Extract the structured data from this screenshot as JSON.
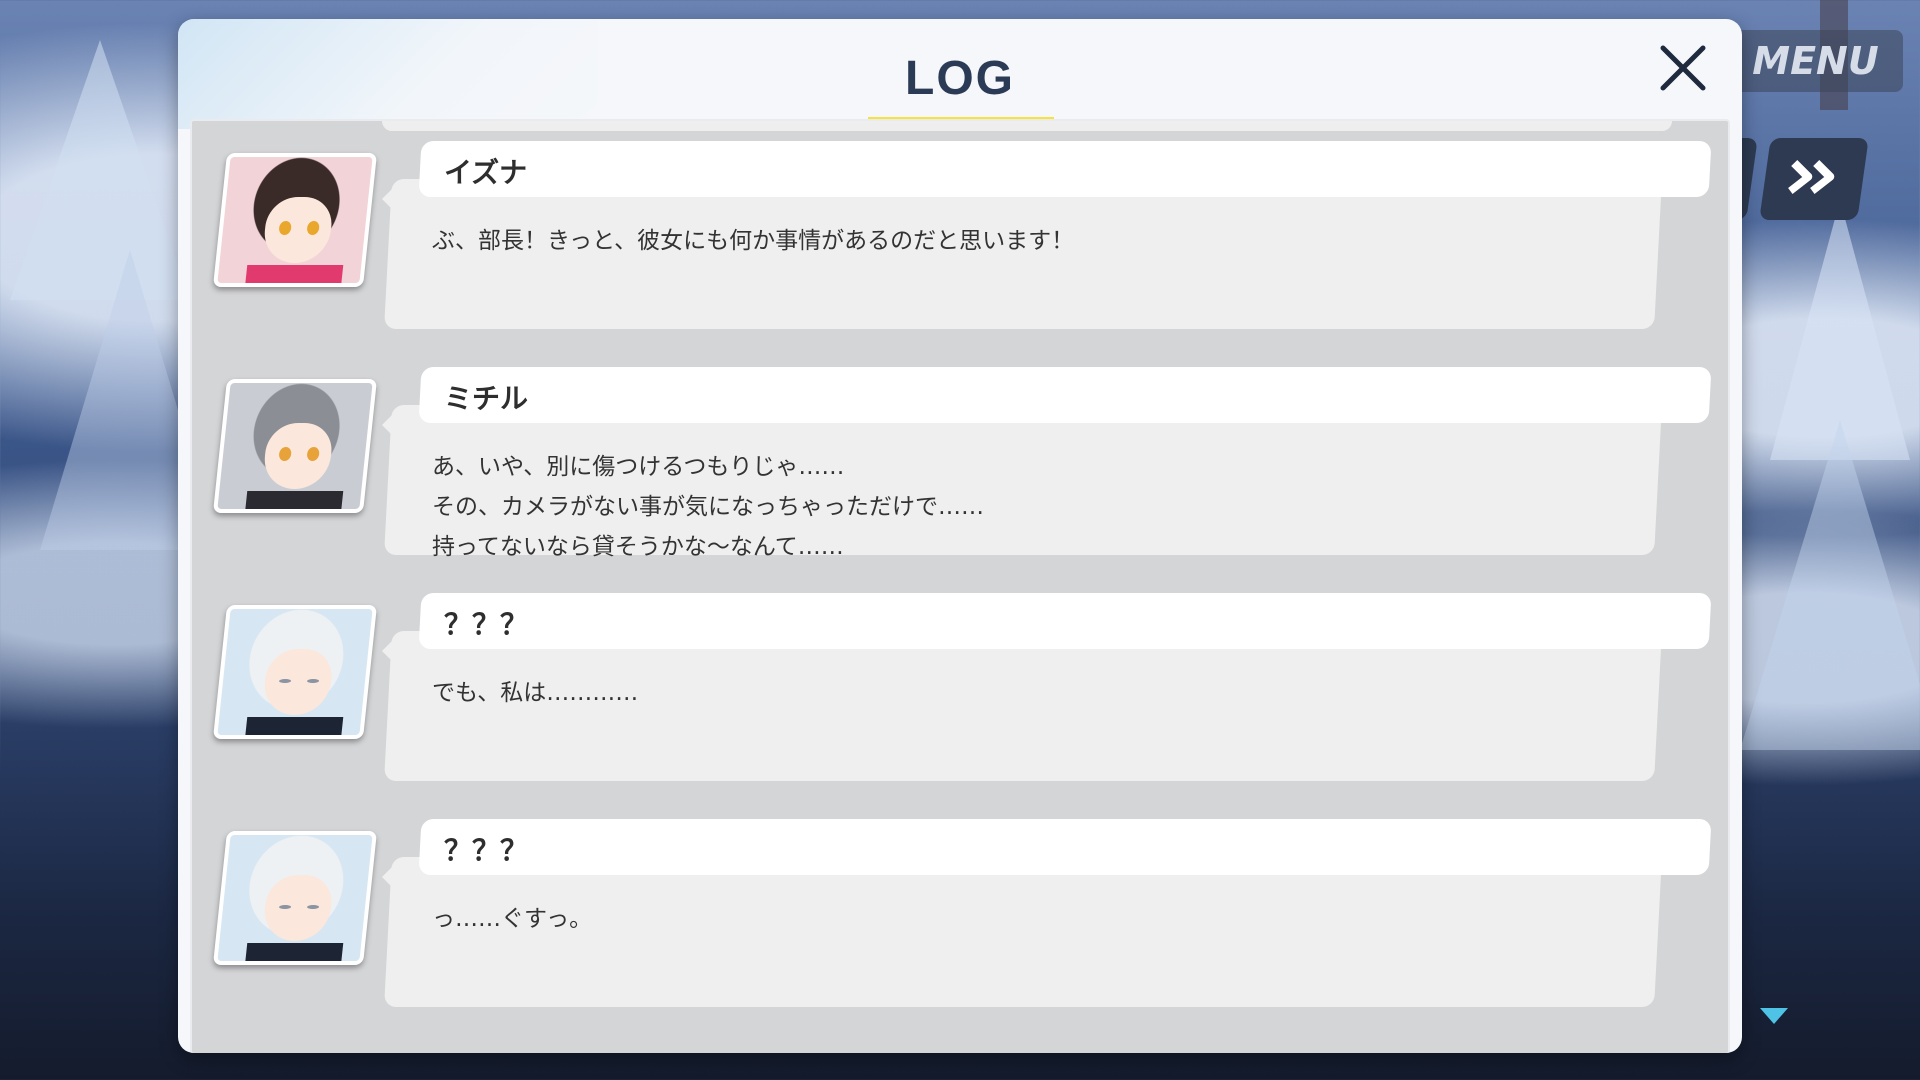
{
  "header": {
    "title": "LOG"
  },
  "controls": {
    "menu_label": "MENU"
  },
  "entries": [
    {
      "speaker": "イズナ",
      "avatar_icon": "izuna-portrait-icon",
      "lines": [
        "ぶ、部長！きっと、彼女にも何か事情があるのだと思います！"
      ]
    },
    {
      "speaker": "ミチル",
      "avatar_icon": "michiru-portrait-icon",
      "lines": [
        "あ、いや、別に傷つけるつもりじゃ……",
        "その、カメラがない事が気になっちゃっただけで……",
        "持ってないなら貸そうかな～なんて……"
      ]
    },
    {
      "speaker": "？？？",
      "avatar_icon": "unknown-girl-portrait-icon",
      "lines": [
        "でも、私は…………"
      ]
    },
    {
      "speaker": "？？？",
      "avatar_icon": "unknown-girl-portrait-icon",
      "lines": [
        "っ……ぐすっ。"
      ]
    }
  ],
  "colors": {
    "title": "#2b3a55",
    "title_underline": "#f7e13b",
    "panel": "#d4d5d7",
    "bubble": "#efefef",
    "name_plate": "#ffffff",
    "scroll_arrow": "#4fc3e6"
  }
}
